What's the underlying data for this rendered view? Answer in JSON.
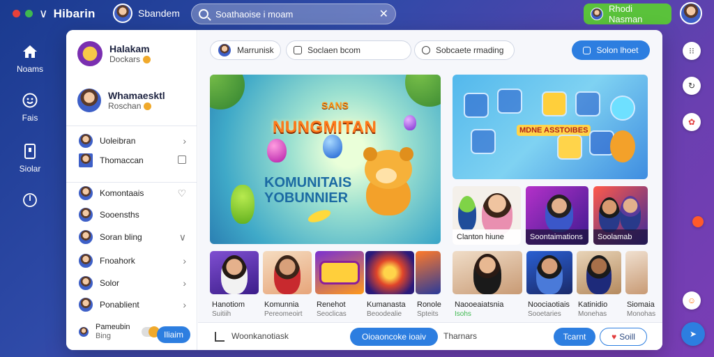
{
  "window": {
    "dots": [
      "#e8413a",
      "#3fb950",
      "#3fb950"
    ]
  },
  "topbar": {
    "brand": "Hibarin",
    "user_name": "Sbandem",
    "search_placeholder": "Soathaoise i moam",
    "cta_label": "Rhodi Nasman"
  },
  "left_rail": {
    "items": [
      {
        "label": "Noams",
        "icon": "home-icon"
      },
      {
        "label": "Fais",
        "icon": "smiley-icon"
      },
      {
        "label": "Siolar",
        "icon": "bookmark-icon"
      },
      {
        "label": "",
        "icon": "power-icon"
      }
    ]
  },
  "sidebar": {
    "profiles": [
      {
        "name": "Halakam",
        "sub": "Dockars"
      },
      {
        "name": "Whamaesktl",
        "sub": "Roschan"
      }
    ],
    "section1": [
      {
        "label": "Uoleibran",
        "right": "›"
      },
      {
        "label": "Thomaccan",
        "right": "checkbox"
      }
    ],
    "section2": [
      {
        "label": "Komontaais",
        "right": "♡"
      },
      {
        "label": "Sooensths",
        "right": ""
      },
      {
        "label": "Soran bling",
        "right": "∨"
      },
      {
        "label": "Fnoahork",
        "right": "›"
      },
      {
        "label": "Solor",
        "right": "›"
      },
      {
        "label": "Ponablient",
        "right": "›"
      }
    ],
    "bottom_user": {
      "name": "Pameubin",
      "sub": "Bing"
    },
    "bottom_button": "Iliaim"
  },
  "content": {
    "chips": {
      "user_chip": "Marrunisk",
      "chip2": "Soclaen bcom",
      "chip3": "Sobcaete rmading",
      "button": "Solon lhoet"
    },
    "hero": {
      "title": "NUNGMITAN",
      "top_text": "SANS",
      "sub_line1": "KOMUNITAIS",
      "sub_line2": "YOBUNNIER"
    },
    "banner2": {
      "title": "MDNE ASSTOIBES"
    },
    "cards": [
      {
        "label": "Clanton hiune"
      },
      {
        "label": "Soontaimations"
      },
      {
        "label": "Soolamab"
      }
    ],
    "thumbs": [
      {
        "title": "Hanotiom",
        "sub": "Suitiih"
      },
      {
        "title": "Komunnia",
        "sub": "Pereomeoirt"
      },
      {
        "title": "Renehot",
        "sub": "Seoclicas"
      },
      {
        "title": "Kumanasta",
        "sub": "Beoodealie"
      },
      {
        "title": "Ronole",
        "sub": "Spteits"
      },
      {
        "title": "Naooeaiatsnia",
        "sub": "Isohs"
      },
      {
        "title": "Noociaotiais",
        "sub": "Sooetaries"
      },
      {
        "title": "Katinidio",
        "sub": "Monehas"
      },
      {
        "title": "Siomaia",
        "sub": "Monohas"
      }
    ],
    "bottombar": {
      "left_text": "Woonkanotiask",
      "pill": "Oioaoncoke ioaiv",
      "mid_text": "Tharnars",
      "start": "Tcarnt",
      "out": "Soill"
    }
  },
  "right_rail": {
    "icons": [
      "dots-icon",
      "refresh-icon",
      "apps-icon",
      "notification-dot-icon",
      "emoji-icon",
      "compass-icon"
    ]
  }
}
